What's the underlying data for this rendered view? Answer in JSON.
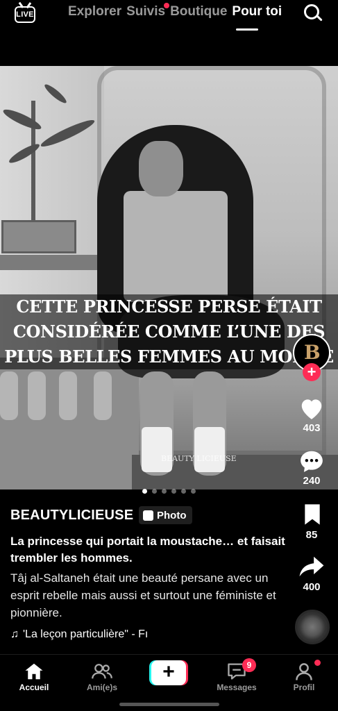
{
  "topbar": {
    "live_label": "LIVE",
    "tabs": [
      {
        "label": "Explorer"
      },
      {
        "label": "Suivis"
      },
      {
        "label": "Boutique"
      },
      {
        "label": "Pour toi"
      }
    ],
    "active_tab": "Pour toi"
  },
  "post": {
    "overlay_lines": [
      "CETTE PRINCESSE PERSE ÉTAIT",
      "CONSIDÉRÉE COMME L’UNE DES",
      "PLUS BELLES FEMMES AU MONDE"
    ],
    "watermark": "BEAUTY LICIEUSE",
    "carousel": {
      "total": 6,
      "current": 1
    },
    "username": "BEAUTYLICIEUSE",
    "badge": "Photo",
    "caption_title": "La princesse qui portait la moustache… et faisait trembler les hommes.",
    "caption_body": "Tâj al-Saltaneh était une beauté persane avec un esprit rebelle mais aussi et surtout une féministe et pionnière.",
    "music": "'La leçon particulière\" - Fı"
  },
  "rail": {
    "likes": "403",
    "comments": "240",
    "saves": "85",
    "shares": "400"
  },
  "bottom_nav": {
    "items": [
      {
        "label": "Accueil",
        "icon": "home-icon"
      },
      {
        "label": "Ami(e)s",
        "icon": "friends-icon"
      },
      {
        "label": "",
        "icon": "plus-icon"
      },
      {
        "label": "Messages",
        "icon": "message-icon"
      },
      {
        "label": "Profil",
        "icon": "profile-icon"
      }
    ],
    "messages_badge": "9"
  },
  "colors": {
    "accent_red": "#fe2c55",
    "accent_cyan": "#25f4ee",
    "background": "#000000"
  }
}
